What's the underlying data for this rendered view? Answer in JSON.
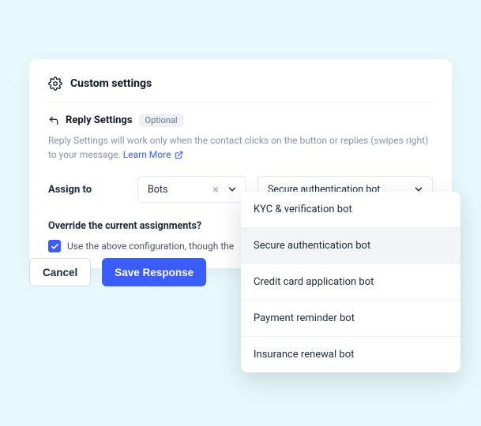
{
  "card": {
    "title": "Custom settings",
    "reply": {
      "title": "Reply Settings",
      "badge": "Optional",
      "description": "Reply Settings will work only when the contact clicks on the button or replies (swipes right) to your message.",
      "learn_more": "Learn More"
    },
    "assign": {
      "label": "Assign to",
      "type_value": "Bots",
      "bot_value": "Secure authentication bot"
    },
    "override": {
      "question": "Override the current assignments?",
      "checkbox_label": "Use the above configuration, though the"
    }
  },
  "buttons": {
    "cancel": "Cancel",
    "save": "Save Response"
  },
  "dropdown": {
    "options": [
      "KYC & verification bot",
      "Secure authentication bot",
      "Credit card application bot",
      "Payment reminder bot",
      "Insurance renewal bot"
    ],
    "selected_index": 1
  }
}
